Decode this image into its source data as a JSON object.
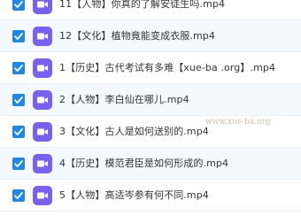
{
  "files": [
    {
      "name": "11【人物】你真的了解安徒生吗.mp4",
      "checked": true,
      "icon": "video-icon"
    },
    {
      "name": "12【文化】植物竟能变成衣服.mp4",
      "checked": true,
      "icon": "video-icon"
    },
    {
      "name": "1【历史】古代考试有多难【xue-ba .org】.mp4",
      "checked": true,
      "icon": "video-icon"
    },
    {
      "name": "2【人物】李白仙在哪儿.mp4",
      "checked": true,
      "icon": "video-icon"
    },
    {
      "name": "3【文化】古人是如何送别的.mp4",
      "checked": true,
      "icon": "video-icon"
    },
    {
      "name": "4【历史】模范君臣是如何形成的.mp4",
      "checked": true,
      "icon": "video-icon"
    },
    {
      "name": "5【人物】高适岑参有何不同.mp4",
      "checked": true,
      "icon": "video-icon"
    }
  ],
  "watermark": "www.xue-ba.org",
  "colors": {
    "checkbox": "#1f88e5",
    "video_icon": "#7a60f0",
    "row_alt": "#f4f8ff",
    "text": "#333333"
  }
}
